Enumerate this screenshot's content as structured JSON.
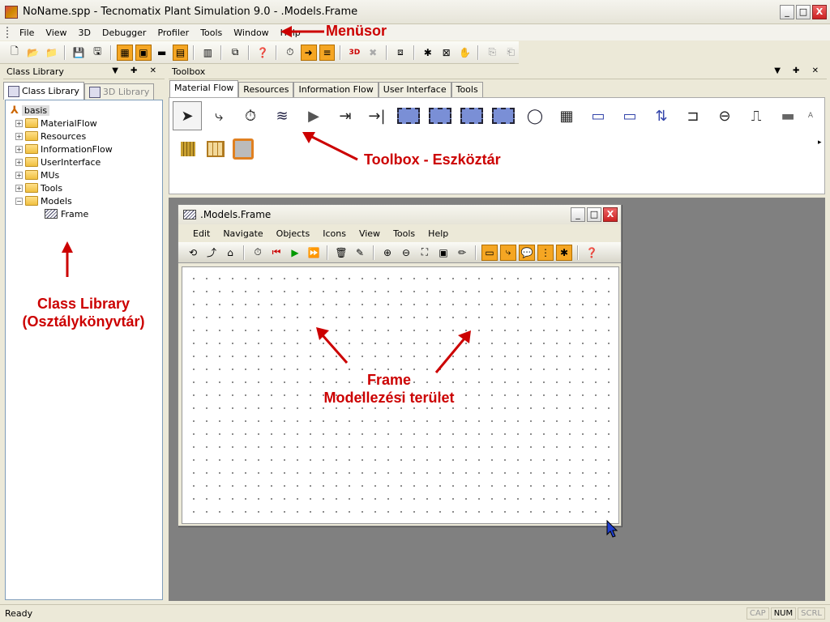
{
  "window": {
    "title": "NoName.spp - Tecnomatix Plant Simulation 9.0 - .Models.Frame",
    "min": "_",
    "max": "□",
    "close": "X"
  },
  "menubar": {
    "items": [
      "File",
      "View",
      "3D",
      "Debugger",
      "Profiler",
      "Tools",
      "Window",
      "Help"
    ]
  },
  "annotations": {
    "menu": "Menüsor",
    "toolbox": "Toolbox - Eszköztár",
    "classlib_line1": "Class Library",
    "classlib_line2": "(Osztálykönyvtár)",
    "frame_line1": "Frame",
    "frame_line2": "Modellezési terület"
  },
  "class_library": {
    "header": "Class Library",
    "controls": "▼ ✚ ✕",
    "tabs": [
      "Class Library",
      "3D Library"
    ],
    "root": "basis",
    "folders": [
      {
        "label": "MaterialFlow",
        "toggle": "+"
      },
      {
        "label": "Resources",
        "toggle": "+"
      },
      {
        "label": "InformationFlow",
        "toggle": "+"
      },
      {
        "label": "UserInterface",
        "toggle": "+"
      },
      {
        "label": "MUs",
        "toggle": "+"
      },
      {
        "label": "Tools",
        "toggle": "+"
      },
      {
        "label": "Models",
        "toggle": "−"
      }
    ],
    "leaf": "Frame"
  },
  "toolbox": {
    "header": "Toolbox",
    "controls": "▼ ✚ ✕",
    "tabs": [
      "Material Flow",
      "Resources",
      "Information Flow",
      "User Interface",
      "Tools"
    ],
    "active_tab": "Material Flow",
    "scroll_arrow": "▸"
  },
  "frame_window": {
    "title": ".Models.Frame",
    "min": "_",
    "max": "□",
    "close": "X",
    "menu": [
      "Edit",
      "Navigate",
      "Objects",
      "Icons",
      "View",
      "Tools",
      "Help"
    ]
  },
  "status": {
    "text": "Ready",
    "indicators": [
      {
        "label": "CAP",
        "on": false
      },
      {
        "label": "NUM",
        "on": true
      },
      {
        "label": "SCRL",
        "on": false
      }
    ]
  },
  "colors": {
    "annotation": "#cc0000",
    "workspace": "#808080",
    "toggle_on": "#f5a623"
  }
}
